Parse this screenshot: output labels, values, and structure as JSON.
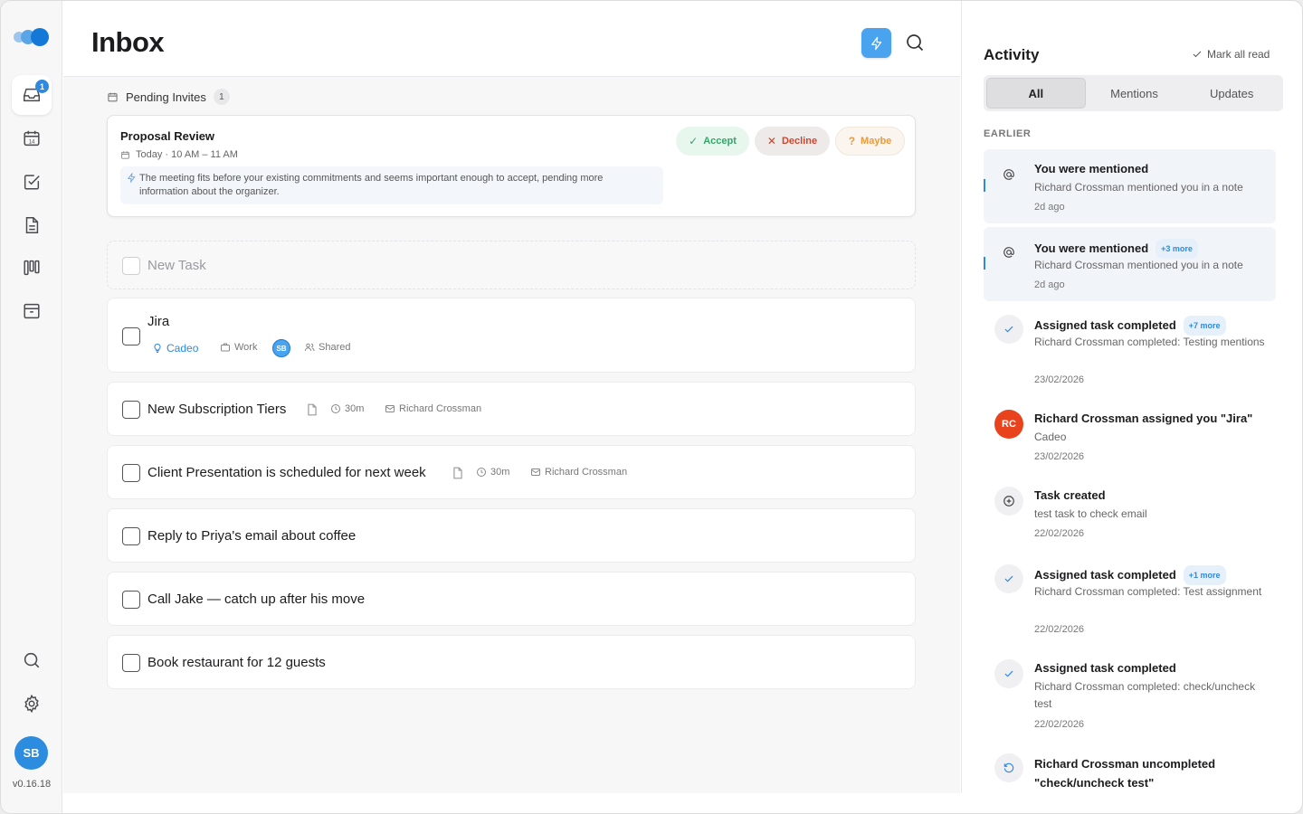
{
  "app": {
    "version": "v0.16.18",
    "avatar_initials": "SB",
    "inbox_badge": "1",
    "accent": "#2d8ae0"
  },
  "inbox": {
    "title": "Inbox",
    "pending": {
      "label": "Pending Invites",
      "count": "1"
    },
    "invite": {
      "title": "Proposal Review",
      "time": "Today · 10 AM – 11 AM",
      "note": "The meeting fits before your existing commitments and seems important enough to accept, pending more information about the organizer.",
      "accept": "Accept",
      "decline": "Decline",
      "maybe": "Maybe"
    },
    "new_task_placeholder": "New Task",
    "tasks": [
      {
        "title": "Jira",
        "project": "Cadeo",
        "area": "Work",
        "assignee": "SB",
        "sharing": "Shared"
      },
      {
        "title": "New Subscription Tiers",
        "duration": "30m",
        "from": "Richard Crossman"
      },
      {
        "title": "Client Presentation is scheduled for next week",
        "duration": "30m",
        "from": "Richard Crossman"
      },
      {
        "title": "Reply to Priya's email about coffee"
      },
      {
        "title": "Call Jake — catch up after his move"
      },
      {
        "title": "Book restaurant for 12 guests"
      }
    ]
  },
  "activity": {
    "title": "Activity",
    "mark_all_read": "Mark all read",
    "tabs": [
      "All",
      "Mentions",
      "Updates"
    ],
    "active_tab": "All",
    "section": "EARLIER",
    "items": [
      {
        "title": "You were mentioned",
        "body": "Richard Crossman mentioned you in a note",
        "date": "2d ago",
        "icon": "at-icon"
      },
      {
        "title": "You were mentioned",
        "more": "+3 more",
        "body": "Richard Crossman mentioned you in a note",
        "date": "2d ago",
        "icon": "at-icon"
      },
      {
        "title": "Assigned task completed",
        "more": "+7 more",
        "body": "Richard Crossman completed: Testing mentions",
        "date": "23/02/2026",
        "icon": "check-icon"
      },
      {
        "title": "Richard Crossman assigned you \"Jira\"",
        "body": "Cadeo",
        "date": "23/02/2026",
        "avatar": "RC"
      },
      {
        "title": "Task created",
        "body": "test task to check email",
        "date": "22/02/2026",
        "icon": "plus-circle-icon"
      },
      {
        "title": "Assigned task completed",
        "more": "+1 more",
        "body": "Richard Crossman completed: Test assignment",
        "date": "22/02/2026",
        "icon": "check-icon"
      },
      {
        "title": "Assigned task completed",
        "body": "Richard Crossman completed: check/uncheck test",
        "date": "22/02/2026",
        "icon": "check-icon"
      },
      {
        "title": "Richard Crossman uncompleted \"check/uncheck test\"",
        "icon": "undo-icon"
      }
    ]
  }
}
